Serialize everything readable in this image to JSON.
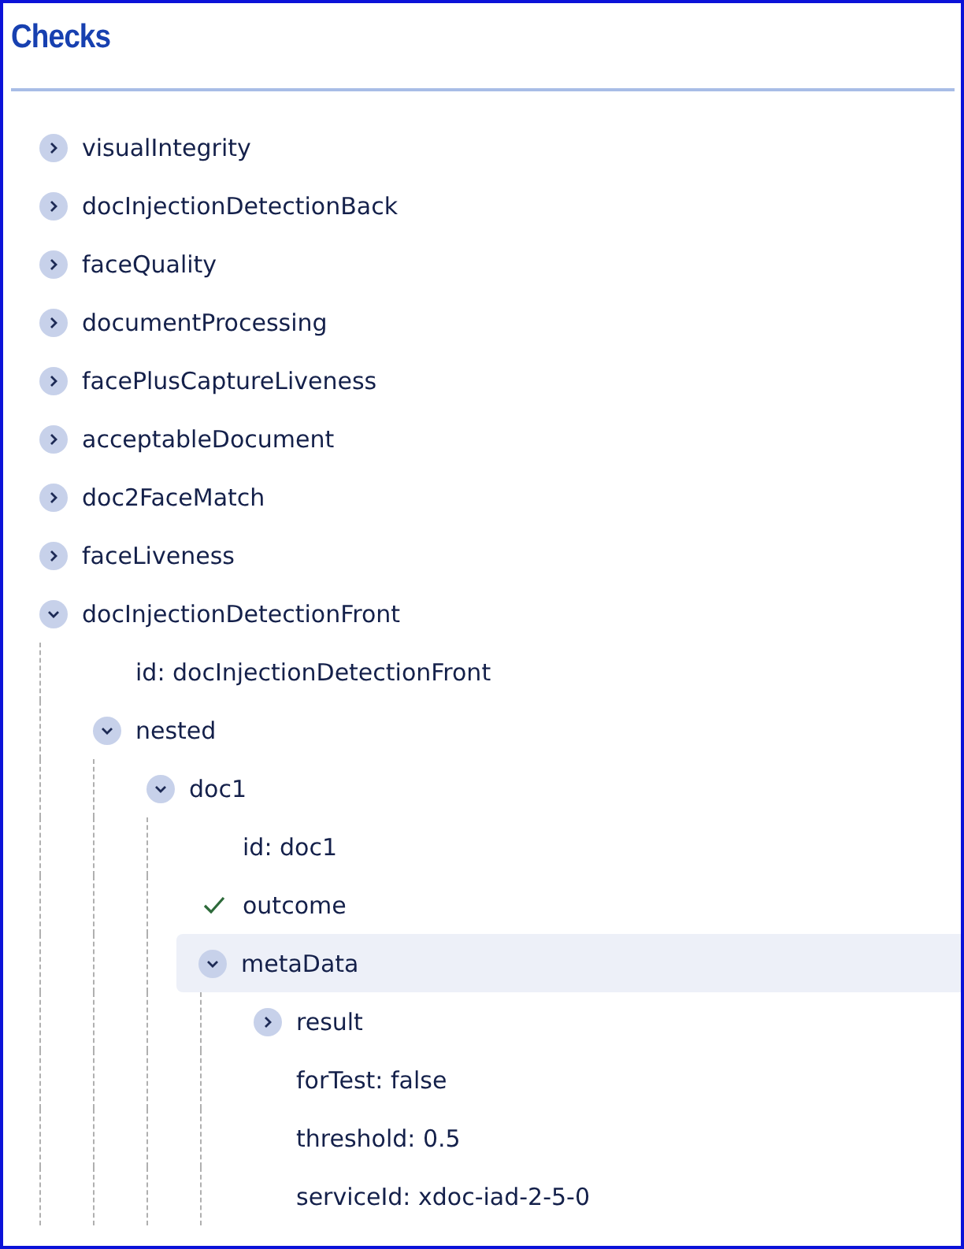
{
  "title": "Checks",
  "checks": [
    {
      "kind": "branch",
      "label": "visualIntegrity",
      "expanded": false,
      "selected": false
    },
    {
      "kind": "branch",
      "label": "docInjectionDetectionBack",
      "expanded": false,
      "selected": false
    },
    {
      "kind": "branch",
      "label": "faceQuality",
      "expanded": false,
      "selected": false
    },
    {
      "kind": "branch",
      "label": "documentProcessing",
      "expanded": false,
      "selected": false
    },
    {
      "kind": "branch",
      "label": "facePlusCaptureLiveness",
      "expanded": false,
      "selected": false
    },
    {
      "kind": "branch",
      "label": "acceptableDocument",
      "expanded": false,
      "selected": false
    },
    {
      "kind": "branch",
      "label": "doc2FaceMatch",
      "expanded": false,
      "selected": false
    },
    {
      "kind": "branch",
      "label": "faceLiveness",
      "expanded": false,
      "selected": false
    },
    {
      "kind": "branch",
      "label": "docInjectionDetectionFront",
      "expanded": true,
      "selected": false,
      "children": [
        {
          "kind": "leaf",
          "label": "id: docInjectionDetectionFront",
          "selected": false
        },
        {
          "kind": "branch",
          "label": "nested",
          "expanded": true,
          "selected": false,
          "children": [
            {
              "kind": "branch",
              "label": "doc1",
              "expanded": true,
              "selected": false,
              "children": [
                {
                  "kind": "leaf",
                  "label": "id: doc1",
                  "selected": false
                },
                {
                  "kind": "check",
                  "label": "outcome",
                  "selected": false
                },
                {
                  "kind": "branch",
                  "label": "metaData",
                  "expanded": true,
                  "selected": true,
                  "children": [
                    {
                      "kind": "branch",
                      "label": "result",
                      "expanded": false,
                      "selected": false
                    },
                    {
                      "kind": "leaf",
                      "label": "forTest: false",
                      "selected": false
                    },
                    {
                      "kind": "leaf",
                      "label": "threshold: 0.5",
                      "selected": false
                    },
                    {
                      "kind": "leaf",
                      "label": "serviceId: xdoc-iad-2-5-0",
                      "selected": false
                    }
                  ]
                }
              ]
            }
          ]
        }
      ]
    }
  ]
}
